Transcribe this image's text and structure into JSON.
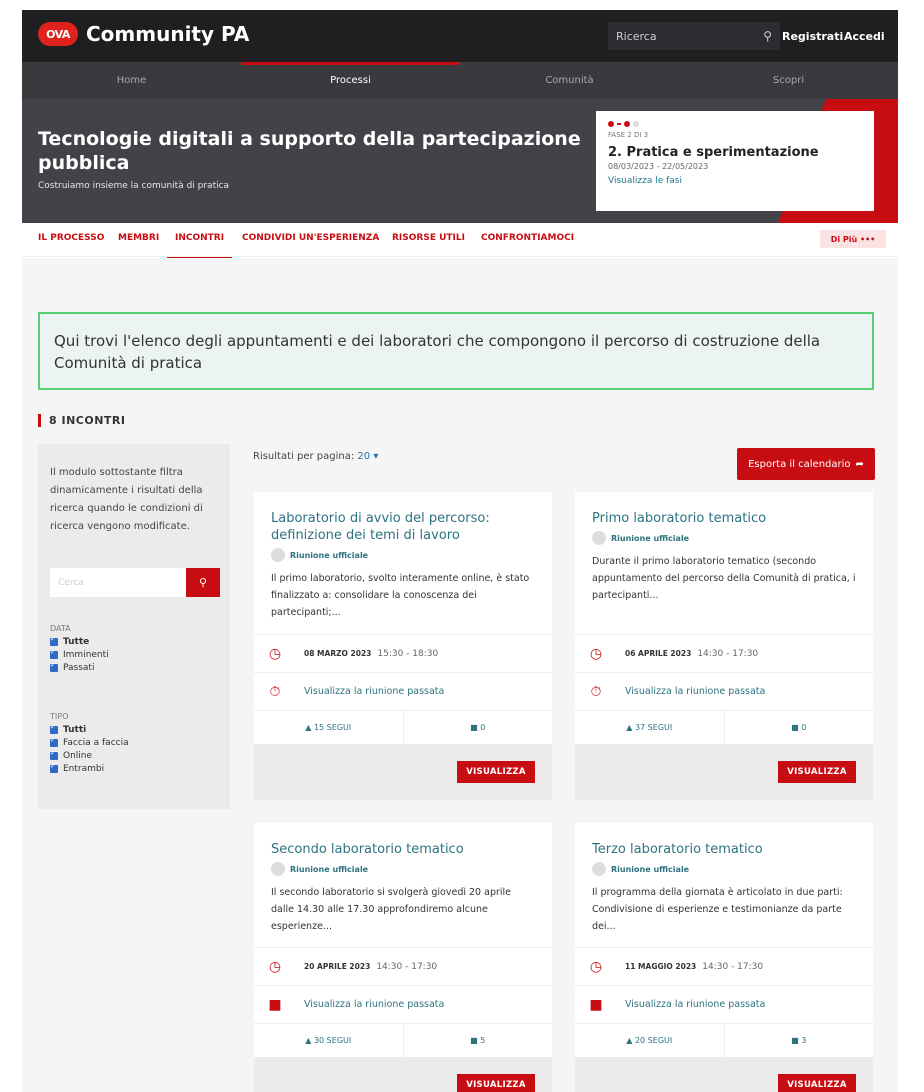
{
  "header": {
    "logo_badge": "OVA",
    "logo_text": "Community PA",
    "search_placeholder": "Ricerca",
    "register": "Registrati",
    "login": "Accedi"
  },
  "nav": {
    "items": [
      {
        "label": "Home"
      },
      {
        "label": "Processi"
      },
      {
        "label": "Comunità"
      },
      {
        "label": "Scopri"
      }
    ]
  },
  "hero": {
    "title": "Tecnologie digitali a supporto della partecipazione pubblica",
    "subtitle": "Costruiamo insieme la comunità di pratica",
    "phase_label": "FASE 2 DI 3",
    "phase_name": "2. Pratica e sperimentazione",
    "phase_dates": "08/03/2023 - 22/05/2023",
    "phase_link": "Visualizza le fasi"
  },
  "subnav": {
    "items": [
      {
        "label": "IL PROCESSO"
      },
      {
        "label": "MEMBRI"
      },
      {
        "label": "INCONTRI"
      },
      {
        "label": "CONDIVIDI UN'ESPERIENZA"
      },
      {
        "label": "RISORSE UTILI"
      },
      {
        "label": "CONFRONTIAMOCI"
      }
    ],
    "more": "Di Più •••"
  },
  "intro": "Qui trovi l'elenco degli appuntamenti e dei laboratori che compongono il percorso di costruzione della Comunità di pratica",
  "count_title": "8 INCONTRI",
  "filters": {
    "description": "Il modulo sottostante filtra dinamicamente i risultati della ricerca quando le condizioni di ricerca vengono modificate.",
    "search_placeholder": "Cerca",
    "data_heading": "DATA",
    "data_options": [
      "Tutte",
      "Imminenti",
      "Passati"
    ],
    "tipo_heading": "TIPO",
    "tipo_options": [
      "Tutti",
      "Faccia a faccia",
      "Online",
      "Entrambi"
    ]
  },
  "results": {
    "per_page_label": "Risultati per pagina:",
    "per_page_value": "20",
    "export": "Esporta il calendario"
  },
  "cards": [
    {
      "title": "Laboratorio di avvio del percorso: definizione dei temi di lavoro",
      "badge": "Riunione ufficiale",
      "desc": "Il primo laboratorio, svolto interamente online, è stato finalizzato a: consolidare la conoscenza dei partecipanti;...",
      "date": "08 MARZO 2023",
      "time": "15:30 - 18:30",
      "link": "Visualizza la riunione passata",
      "follow": "▲ 15 SEGUI",
      "comments": "■ 0",
      "button": "VISUALIZZA"
    },
    {
      "title": "Primo laboratorio tematico",
      "badge": "Riunione ufficiale",
      "desc": "Durante il primo laboratorio tematico (secondo appuntamento del percorso della Comunità di pratica, i partecipanti...",
      "date": "06 APRILE 2023",
      "time": "14:30 - 17:30",
      "link": "Visualizza la riunione passata",
      "follow": "▲ 37 SEGUI",
      "comments": "■ 0",
      "button": "VISUALIZZA"
    },
    {
      "title": "Secondo laboratorio tematico",
      "badge": "Riunione ufficiale",
      "desc": "Il secondo laboratorio si svolgerà giovedì 20 aprile dalle 14.30 alle 17.30 approfondiremo alcune esperienze...",
      "date": "20 APRILE 2023",
      "time": "14:30 - 17:30",
      "link": "Visualizza la riunione passata",
      "follow": "▲ 30 SEGUI",
      "comments": "■ 5",
      "button": "VISUALIZZA"
    },
    {
      "title": "Terzo laboratorio tematico",
      "badge": "Riunione ufficiale",
      "desc": "Il programma della giornata è articolato in due parti: Condivisione di esperienze e testimonianze da parte dei...",
      "date": "11 MAGGIO 2023",
      "time": "14:30 - 17:30",
      "link": "Visualizza la riunione passata",
      "follow": "▲ 20 SEGUI",
      "comments": "■ 3",
      "button": "VISUALIZZA"
    }
  ],
  "colors": {
    "accent": "#c80d12",
    "link": "#2e7381",
    "header_bg": "#1f1f22",
    "intro_border": "#56d172"
  }
}
